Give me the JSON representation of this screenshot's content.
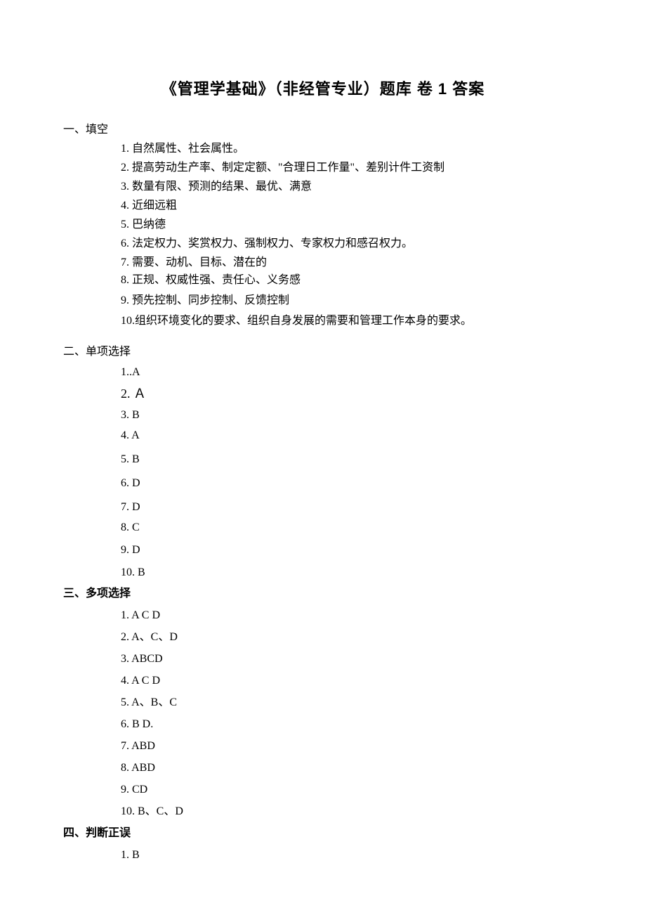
{
  "title": "《管理学基础》（非经管专业）题库  卷 1    答案",
  "sections": {
    "s1": {
      "heading": "一、填空",
      "items": [
        "1.  自然属性、社会属性。",
        "2.  提高劳动生产率、制定定额、\"合理日工作量\"、差别计件工资制",
        "3.  数量有限、预测的结果、最优、满意",
        "4. 近细远粗",
        "5. 巴纳德",
        "6. 法定权力、奖赏权力、强制权力、专家权力和感召权力。",
        "7. 需要、动机、目标、潜在的",
        "8. 正规、权威性强、责任心、义务感",
        "9. 预先控制、同步控制、反馈控制",
        "10.组织环境变化的要求、组织自身发展的需要和管理工作本身的要求。"
      ]
    },
    "s2": {
      "heading": "二、单项选择",
      "items": [
        "1..A",
        "2. Ａ",
        "3. B",
        "4. A",
        "5. B",
        "6. D",
        "7. D",
        "8. C",
        "9. D",
        "10. B"
      ]
    },
    "s3": {
      "heading": "三、多项选择",
      "items": [
        "1. A C D",
        "2. A、C、D",
        "3. ABCD",
        "4. A C D",
        "5. A、B、C",
        "6. B D.",
        "7. ABD",
        "8. ABD",
        "9. CD",
        "10.  B、C、D"
      ]
    },
    "s4": {
      "heading": "四、判断正误",
      "items": [
        "1. B"
      ]
    }
  }
}
